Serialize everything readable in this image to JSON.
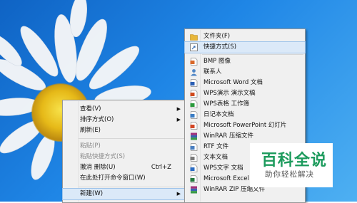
{
  "context_menu": {
    "items": [
      {
        "label": "查看(V)",
        "shortcut": "",
        "submenu": true,
        "disabled": false
      },
      {
        "label": "排序方式(O)",
        "shortcut": "",
        "submenu": true,
        "disabled": false
      },
      {
        "label": "刷新(E)",
        "shortcut": "",
        "submenu": false,
        "disabled": false
      },
      {
        "label": "粘贴(P)",
        "shortcut": "",
        "submenu": false,
        "disabled": true
      },
      {
        "label": "粘贴快捷方式(S)",
        "shortcut": "",
        "submenu": false,
        "disabled": true
      },
      {
        "label": "撤消 删除(U)",
        "shortcut": "Ctrl+Z",
        "submenu": false,
        "disabled": false
      },
      {
        "label": "在此处打开命令窗口(W)",
        "shortcut": "",
        "submenu": false,
        "disabled": false
      },
      {
        "label": "新建(W)",
        "shortcut": "",
        "submenu": true,
        "disabled": false
      }
    ]
  },
  "new_submenu": {
    "items": [
      {
        "label": "文件夹(F)",
        "icon": "folder-icon",
        "color": "#e8b73a"
      },
      {
        "label": "快捷方式(S)",
        "icon": "shortcut-icon",
        "color": "#3a6fb5"
      },
      {
        "label": "BMP 图像",
        "icon": "bitmap-image-icon",
        "color": "#d9682a"
      },
      {
        "label": "联系人",
        "icon": "contact-icon",
        "color": "#4f86c6"
      },
      {
        "label": "Microsoft Word 文档",
        "icon": "word-document-icon",
        "color": "#2b5fb4"
      },
      {
        "label": "WPS演示 演示文稿",
        "icon": "wps-presentation-icon",
        "color": "#d04a1c"
      },
      {
        "label": "WPS表格 工作簿",
        "icon": "wps-spreadsheet-icon",
        "color": "#2a9a3c"
      },
      {
        "label": "日记本文档",
        "icon": "journal-icon",
        "color": "#3a7cc4"
      },
      {
        "label": "Microsoft PowerPoint 幻灯片",
        "icon": "powerpoint-icon",
        "color": "#d24625"
      },
      {
        "label": "WinRAR 压缩文件",
        "icon": "winrar-archive-icon",
        "color": "#8a2a6a"
      },
      {
        "label": "RTF 文件",
        "icon": "rtf-document-icon",
        "color": "#4a7fc0"
      },
      {
        "label": "文本文档",
        "icon": "text-document-icon",
        "color": "#7a7a7a"
      },
      {
        "label": "WPS文字 文档",
        "icon": "wps-writer-icon",
        "color": "#2b6cc4"
      },
      {
        "label": "Microsoft Excel 工",
        "icon": "excel-icon",
        "color": "#217a3c"
      },
      {
        "label": "WinRAR ZIP 压缩文件",
        "icon": "winrar-zip-icon",
        "color": "#8a2a6a"
      }
    ]
  },
  "watermark": {
    "title": "百科全说",
    "subtitle": "助你轻松解决",
    "color": "#1d9b5d"
  }
}
